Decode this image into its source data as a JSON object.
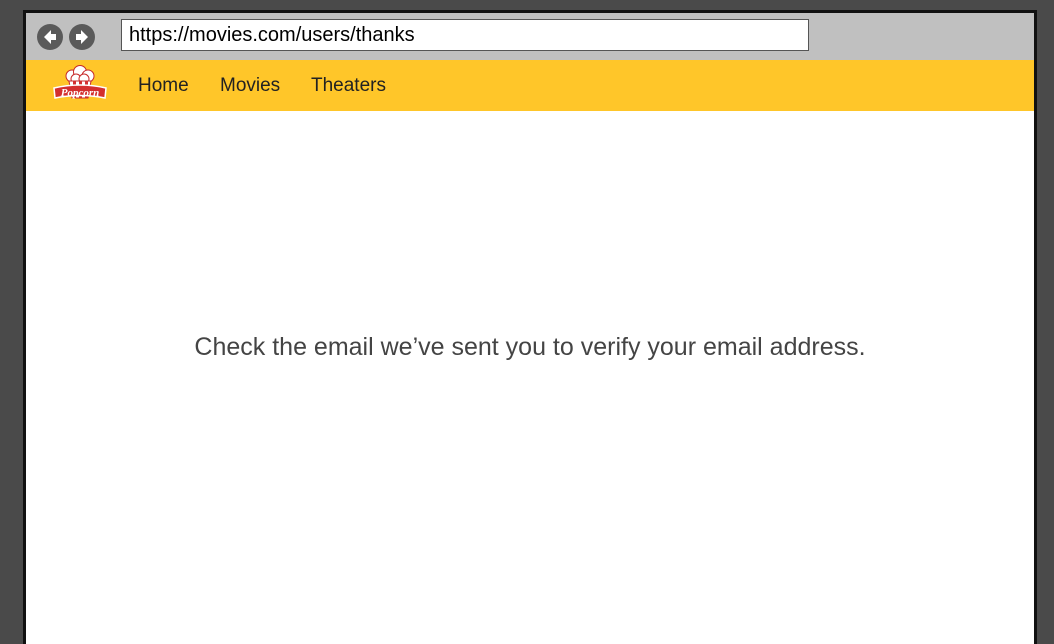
{
  "browser": {
    "url": "https://movies.com/users/thanks",
    "back_icon": "back-arrow-icon",
    "forward_icon": "forward-arrow-icon"
  },
  "header": {
    "logo_text": "Popcorn",
    "nav_items": [
      {
        "label": "Home"
      },
      {
        "label": "Movies"
      },
      {
        "label": "Theaters"
      }
    ],
    "background_color": "#ffc629"
  },
  "main": {
    "message": "Check the email we’ve sent you to verify your email address."
  }
}
